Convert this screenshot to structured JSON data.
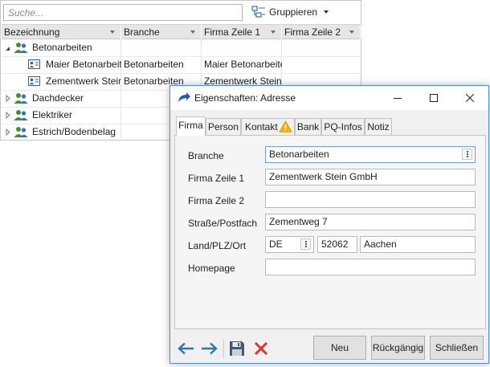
{
  "list": {
    "search_placeholder": "Suche...",
    "group_label": "Gruppieren",
    "columns": [
      "Bezeichnung",
      "Branche",
      "Firma Zeile 1",
      "Firma Zeile 2"
    ],
    "groups": [
      {
        "label": "Betonarbeiten",
        "expanded": true
      },
      {
        "label": "Dachdecker",
        "expanded": false
      },
      {
        "label": "Elektriker",
        "expanded": false
      },
      {
        "label": "Estrich/Bodenbelag",
        "expanded": false
      }
    ],
    "rows": [
      {
        "name": "Maier Betonarbeit...",
        "branche": "Betonarbeiten",
        "firma1": "Maier Betonarbeite...",
        "firma2": ""
      },
      {
        "name": "Zementwerk Stein...",
        "branche": "Betonarbeiten",
        "firma1": "Zementwerk Stein...",
        "firma2": ""
      }
    ]
  },
  "dialog": {
    "title": "Eigenschaften: Adresse",
    "tabs": [
      "Firma",
      "Person",
      "Kontakt",
      "Bank",
      "PQ-Infos",
      "Notiz"
    ],
    "active_tab": "Firma",
    "fields": {
      "branche": {
        "label": "Branche",
        "value": "Betonarbeiten"
      },
      "firma1": {
        "label": "Firma Zeile 1",
        "value": "Zementwerk Stein GmbH"
      },
      "firma2": {
        "label": "Firma Zeile 2",
        "value": ""
      },
      "strasse": {
        "label": "Straße/Postfach",
        "value": "Zementweg 7"
      },
      "land_plz_ort": {
        "label": "Land/PLZ/Ort",
        "land": "DE",
        "plz": "52062",
        "ort": "Aachen"
      },
      "homepage": {
        "label": "Homepage",
        "value": ""
      }
    },
    "buttons": {
      "new": "Neu",
      "undo": "Rückgängig",
      "close": "Schließen"
    },
    "icons": [
      "dialog-app-icon",
      "back-arrow-icon",
      "forward-arrow-icon",
      "save-icon",
      "delete-icon",
      "warning-icon",
      "group-icon",
      "contact-card-icon",
      "minimize-icon",
      "maximize-icon",
      "close-icon"
    ],
    "colors": {
      "accent": "#2e75b6",
      "delete": "#e03030",
      "warning": "#f0b400",
      "group": "#4a8c3c"
    }
  }
}
